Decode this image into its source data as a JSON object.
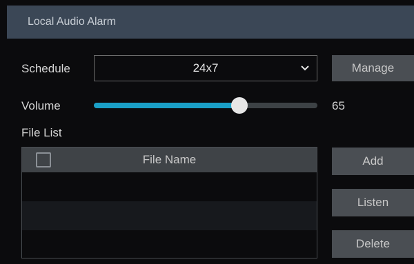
{
  "window": {
    "title": "Local Audio Alarm"
  },
  "schedule": {
    "label": "Schedule",
    "value": "24x7",
    "manage_label": "Manage"
  },
  "volume": {
    "label": "Volume",
    "value": 65,
    "value_text": "65",
    "max": 100
  },
  "file_list": {
    "label": "File List",
    "columns": [
      "File Name"
    ],
    "rows": []
  },
  "buttons": {
    "add": "Add",
    "listen": "Listen",
    "delete": "Delete"
  },
  "colors": {
    "accent": "#1aa0c7",
    "titlebar": "#3b4756",
    "button": "#4a4e53"
  }
}
